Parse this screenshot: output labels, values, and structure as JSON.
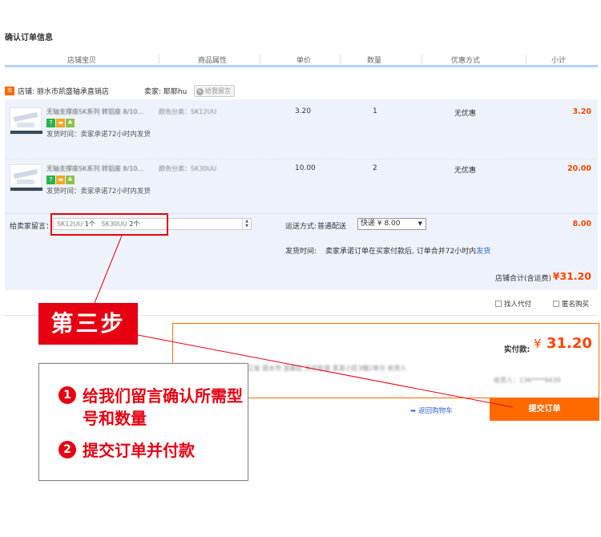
{
  "page_title": "确认订单信息",
  "columns": [
    "店铺宝贝",
    "商品属性",
    "单价",
    "数量",
    "优惠方式",
    "小计"
  ],
  "shop": {
    "badge": "淘",
    "name_label": "店铺: 丽水市凯盛轴承直销店",
    "seller_label": "卖家: 耶耶hu",
    "message_button": "给我留言",
    "message_button_icon": "speech-bubble-icon"
  },
  "items": [
    {
      "title": "无轴支撑座SK系列 转铝座 8/10...",
      "tags": [
        "7",
        "▬",
        "♣"
      ],
      "ship_time": "发货时间：卖家承诺72小时内发货",
      "attr": "颜色分类：SK12UU",
      "price": "3.20",
      "qty": "1",
      "discount": "无优惠",
      "subtotal": "3.20"
    },
    {
      "title": "无轴支撑座SK系列 转铝座 8/10...",
      "tags": [
        "7",
        "▬",
        "♣"
      ],
      "ship_time": "发货时间：卖家承诺72小时内发货",
      "attr": "颜色分类：SK30UU",
      "price": "10.00",
      "qty": "2",
      "discount": "无优惠",
      "subtotal": "20.00"
    }
  ],
  "message": {
    "label": "给卖家留言：",
    "part1_blur": "SK12UU",
    "part1_count": "1个",
    "part2_blur": "SK30UU",
    "part2_count": "2个"
  },
  "shipping": {
    "label": "运送方式:",
    "method": "普通配送",
    "selected": "快递 ¥ 8.00",
    "fee": "8.00",
    "deliver_label": "发货时间:",
    "deliver_text": "卖家承诺订单在买家付款后, 订单合并72小时内",
    "deliver_link": "发货"
  },
  "store_total": {
    "label": "店铺合计(含运费)",
    "value": "¥31.20"
  },
  "options": {
    "pay_for_me": "找人代付",
    "anonymous": "匿名购买"
  },
  "payment": {
    "label": "实付款:",
    "yen": "¥",
    "amount": "31.20",
    "address_line": "寄送至 浙江省 丽水市 莲都区 天宁街道 某某小区3幢2单元 收货人",
    "contact_line": "收货人：136****9439"
  },
  "back_link": "返回购物车",
  "submit_label": "提交订单",
  "step_badge": "第三步",
  "instructions": [
    {
      "num": "1",
      "text": "给我们留言确认所需型号和数量"
    },
    {
      "num": "2",
      "text": "提交订单并付款"
    }
  ],
  "colors": {
    "accent": "#ff6a00",
    "highlight_red": "#e60012",
    "price_red": "#ff4400",
    "block_bg": "#eef3fb"
  }
}
